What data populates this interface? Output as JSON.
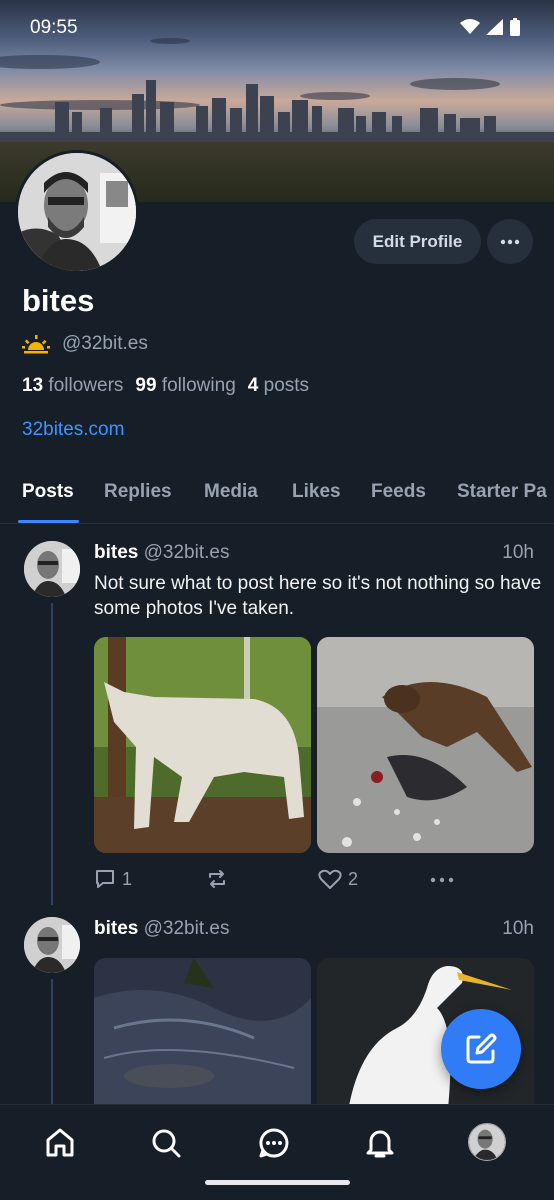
{
  "status_bar": {
    "time": "09:55"
  },
  "profile": {
    "display_name": "bites",
    "handle": "@32bit.es",
    "badge_icon": "sun-emoji-icon",
    "followers_count": "13",
    "followers_label": "followers",
    "following_count": "99",
    "following_label": "following",
    "posts_count": "4",
    "posts_label": "posts",
    "website": "32bites.com",
    "edit_button_label": "Edit Profile"
  },
  "tabs": [
    {
      "label": "Posts",
      "active": true
    },
    {
      "label": "Replies",
      "active": false
    },
    {
      "label": "Media",
      "active": false
    },
    {
      "label": "Likes",
      "active": false
    },
    {
      "label": "Feeds",
      "active": false
    },
    {
      "label": "Starter Pa",
      "active": false
    }
  ],
  "posts": [
    {
      "author": "bites",
      "handle": "@32bit.es",
      "time": "10h",
      "text": "Not sure what to post here so it's not nothing so have some photos I've taken.",
      "images": [
        "white-wolf-photo",
        "hawk-photo"
      ],
      "reply_count": "1",
      "like_count": "2"
    },
    {
      "author": "bites",
      "handle": "@32bit.es",
      "time": "10h",
      "images": [
        "seal-in-water-photo",
        "white-egret-photo"
      ]
    }
  ],
  "bottom_nav": [
    "home-icon",
    "search-icon",
    "chat-icon",
    "bell-icon",
    "profile-avatar"
  ],
  "colors": {
    "accent": "#3d95ff",
    "background": "#161e27",
    "fab": "#2f7cf6"
  }
}
